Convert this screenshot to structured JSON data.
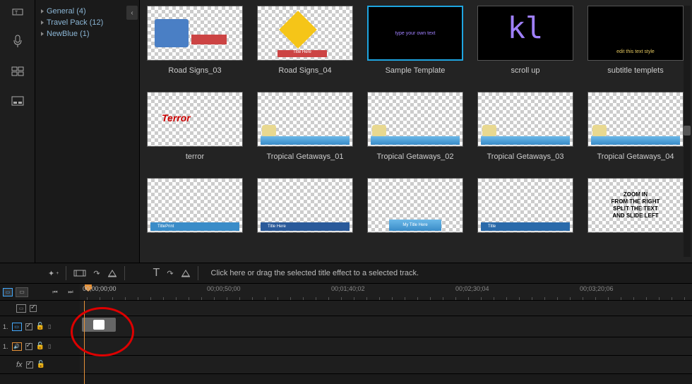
{
  "categories": [
    {
      "label": "General  (4)"
    },
    {
      "label": "Travel Pack  (12)"
    },
    {
      "label": "NewBlue  (1)"
    }
  ],
  "templates": [
    {
      "label": "Road Signs_03",
      "style": "roadsign1"
    },
    {
      "label": "Road Signs_04",
      "style": "roadsign2"
    },
    {
      "label": "Sample Template",
      "style": "sample",
      "selected": true
    },
    {
      "label": "scroll up",
      "style": "kl"
    },
    {
      "label": "subtitle templets",
      "style": "subtitle"
    },
    {
      "label": "terror",
      "style": "terror"
    },
    {
      "label": "Tropical Getaways_01",
      "style": "tg1"
    },
    {
      "label": "Tropical Getaways_02",
      "style": "tg2"
    },
    {
      "label": "Tropical Getaways_03",
      "style": "tg3"
    },
    {
      "label": "Tropical Getaways_04",
      "style": "tg4"
    },
    {
      "label": "",
      "style": "lt1"
    },
    {
      "label": "",
      "style": "lt2"
    },
    {
      "label": "",
      "style": "lt3"
    },
    {
      "label": "",
      "style": "lt4"
    },
    {
      "label": "",
      "style": "zoom"
    }
  ],
  "toolbar": {
    "hint": "Click here or drag the selected title effect to a selected track."
  },
  "timeline": {
    "start": "00;00;00;00",
    "ticks": [
      "00;00;50;00",
      "00;01;40;02",
      "00;02;30;04",
      "00;03;20;06"
    ],
    "tracks": [
      {
        "num": "",
        "type": "monitor"
      },
      {
        "num": "1.",
        "type": "video"
      },
      {
        "num": "1.",
        "type": "audio"
      },
      {
        "num": "",
        "type": "fx"
      }
    ]
  },
  "thumb_text": {
    "sample": "type your own text",
    "kl": "kl",
    "subtitle": "edit this text style",
    "terror": "Terror",
    "mytitle": "My Title Here",
    "zoom": "ZOOM IN<br>FROM THE RIGHT<br>SPLIT THE TEXT<br>AND SLIDE LEFT"
  }
}
